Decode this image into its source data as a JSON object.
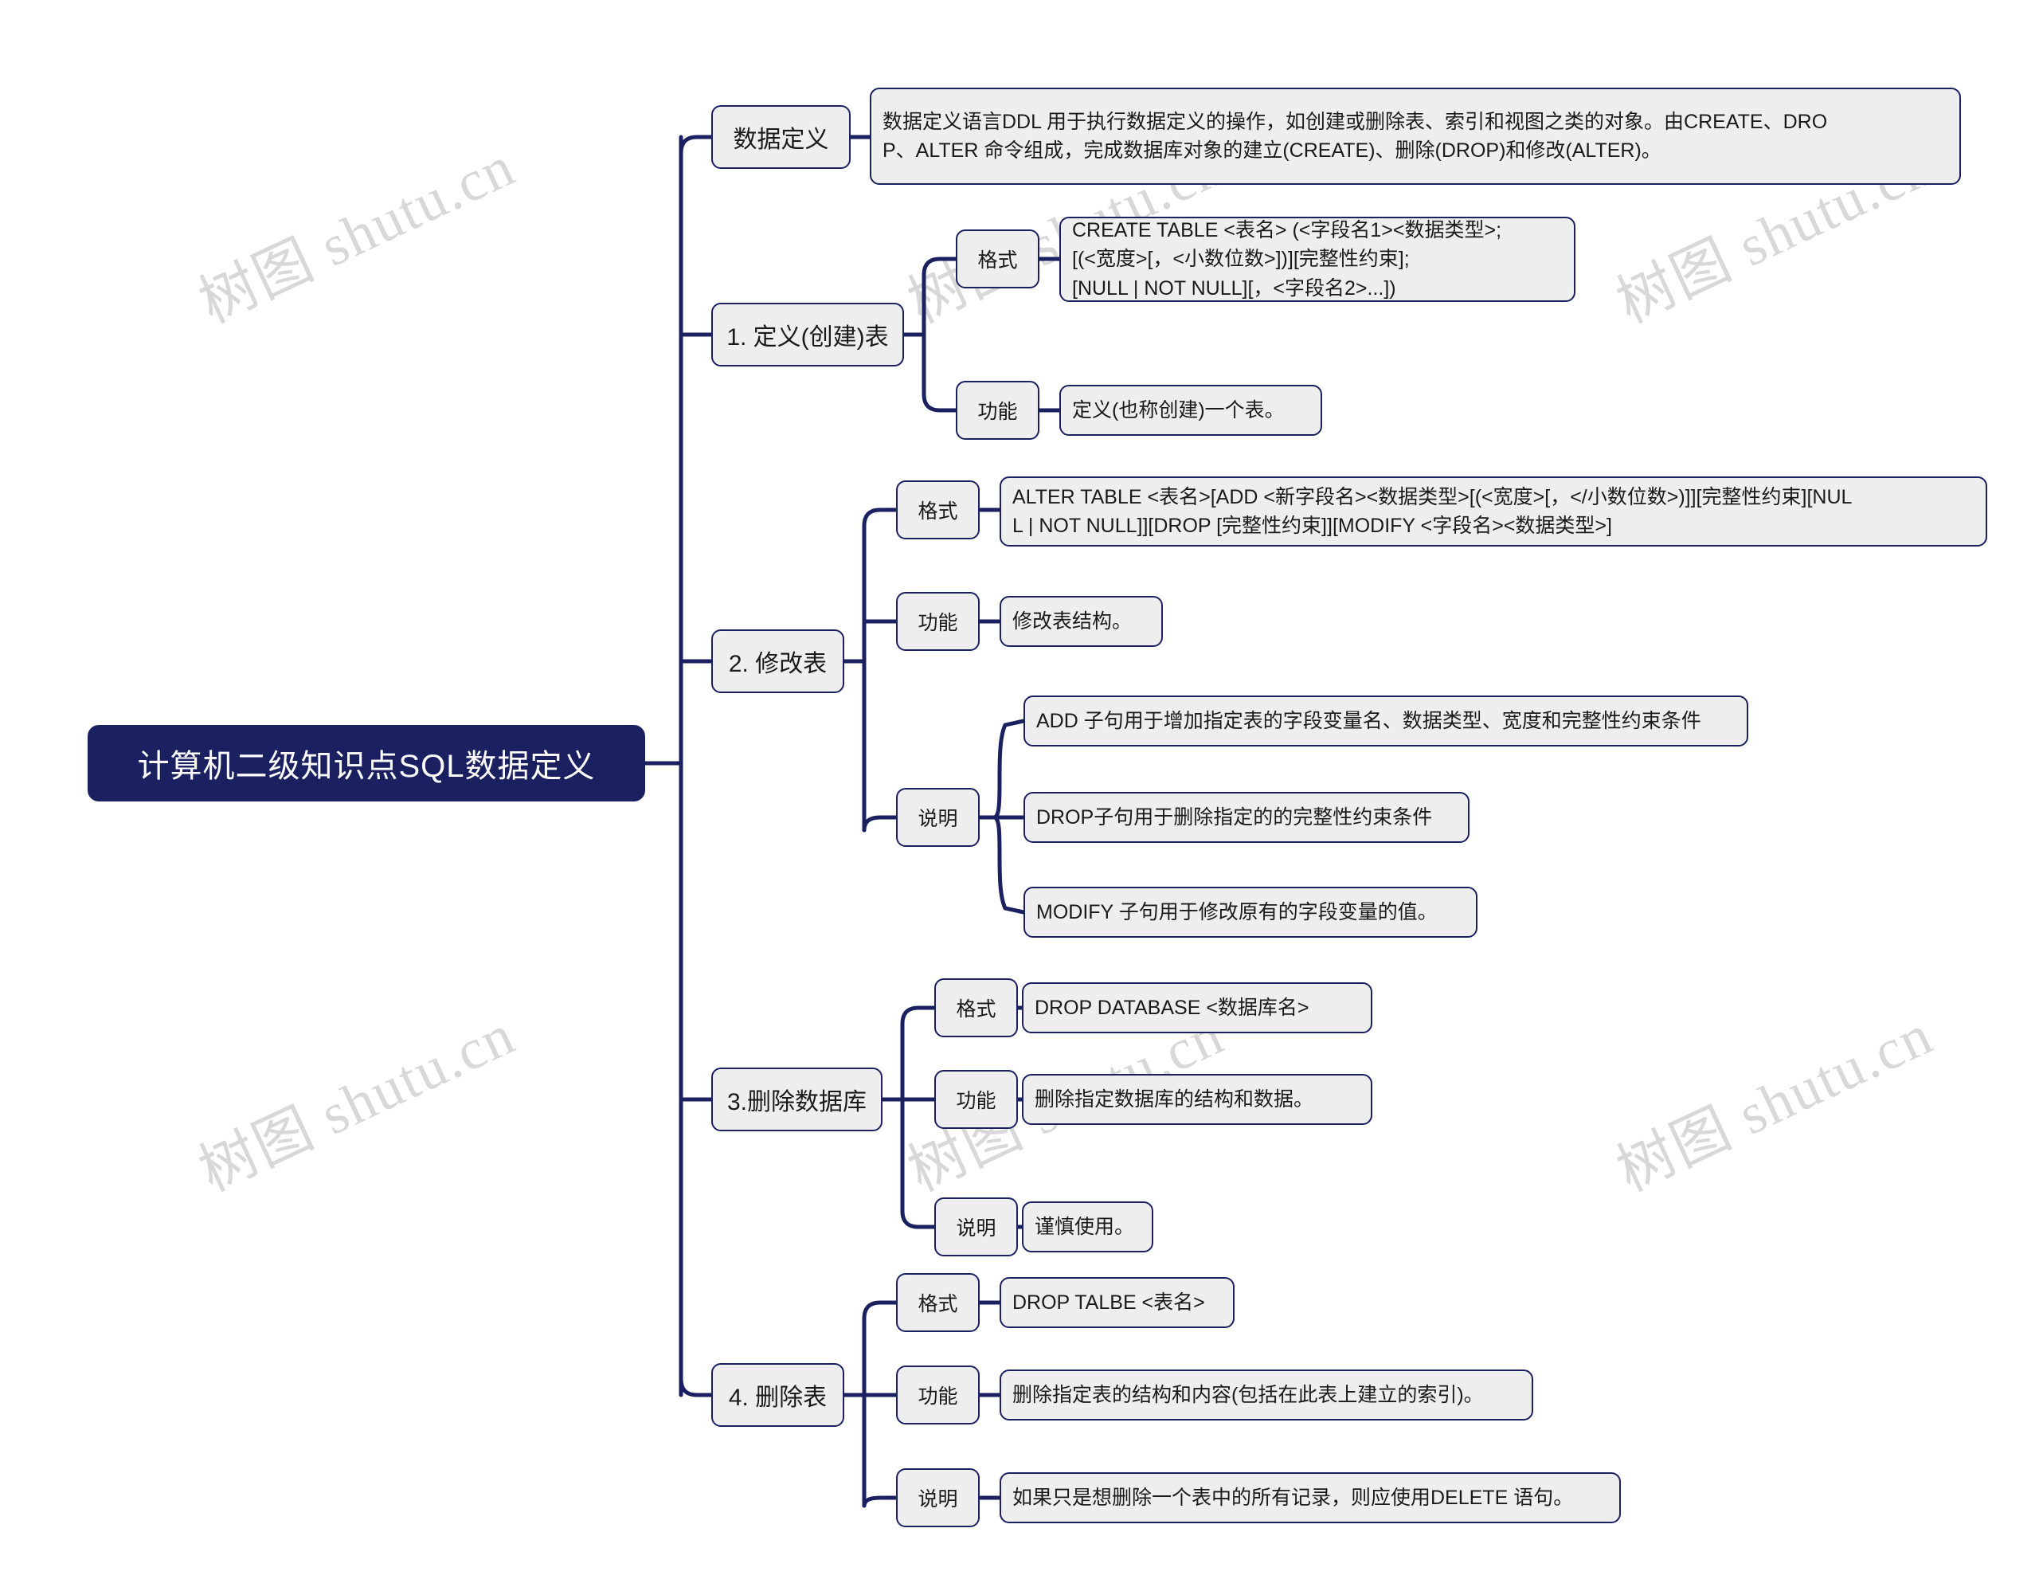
{
  "meta": {
    "watermark_text": "树图 shutu.cn",
    "colors": {
      "root_fill": "#1b2160",
      "root_text": "#ffffff",
      "node_fill": "#eeeeee",
      "node_border": "#1a2060",
      "connector": "#1b2160",
      "watermark": "#d8d8d8",
      "background": "#ffffff"
    }
  },
  "root": {
    "label": "计算机二级知识点SQL数据定义"
  },
  "branches": [
    {
      "label": "数据定义",
      "children": [
        {
          "label": "数据定义语言DDL 用于执行数据定义的操作，如创建或删除表、索引和视图之类的对象。由CREATE、DRO\nP、ALTER 命令组成，完成数据库对象的建立(CREATE)、删除(DROP)和修改(ALTER)。"
        }
      ]
    },
    {
      "label": "1. 定义(创建)表",
      "children": [
        {
          "label": "格式",
          "children": [
            {
              "label": "CREATE TABLE <表名> (<字段名1><数据类型>;\n[(<宽度>[，<小数位数>])][完整性约束];\n[NULL | NOT NULL][，<字段名2>...])"
            }
          ]
        },
        {
          "label": "功能",
          "children": [
            {
              "label": "定义(也称创建)一个表。"
            }
          ]
        }
      ]
    },
    {
      "label": "2. 修改表",
      "children": [
        {
          "label": "格式",
          "children": [
            {
              "label": "ALTER TABLE <表名>[ADD <新字段名><数据类型>[(<宽度>[，</小数位数>)]][完整性约束][NUL\nL | NOT NULL]][DROP [完整性约束]][MODIFY <字段名><数据类型>]"
            }
          ]
        },
        {
          "label": "功能",
          "children": [
            {
              "label": "修改表结构。"
            }
          ]
        },
        {
          "label": "说明",
          "children": [
            {
              "label": "ADD 子句用于增加指定表的字段变量名、数据类型、宽度和完整性约束条件"
            },
            {
              "label": "DROP子句用于删除指定的的完整性约束条件"
            },
            {
              "label": "MODIFY 子句用于修改原有的字段变量的值。"
            }
          ]
        }
      ]
    },
    {
      "label": "3.删除数据库",
      "children": [
        {
          "label": "格式",
          "children": [
            {
              "label": "DROP DATABASE <数据库名>"
            }
          ]
        },
        {
          "label": "功能",
          "children": [
            {
              "label": "删除指定数据库的结构和数据。"
            }
          ]
        },
        {
          "label": "说明",
          "children": [
            {
              "label": "谨慎使用。"
            }
          ]
        }
      ]
    },
    {
      "label": "4. 删除表",
      "children": [
        {
          "label": "格式",
          "children": [
            {
              "label": "DROP TALBE <表名>"
            }
          ]
        },
        {
          "label": "功能",
          "children": [
            {
              "label": "删除指定表的结构和内容(包括在此表上建立的索引)。"
            }
          ]
        },
        {
          "label": "说明",
          "children": [
            {
              "label": "如果只是想删除一个表中的所有记录，则应使用DELETE 语句。"
            }
          ]
        }
      ]
    }
  ]
}
